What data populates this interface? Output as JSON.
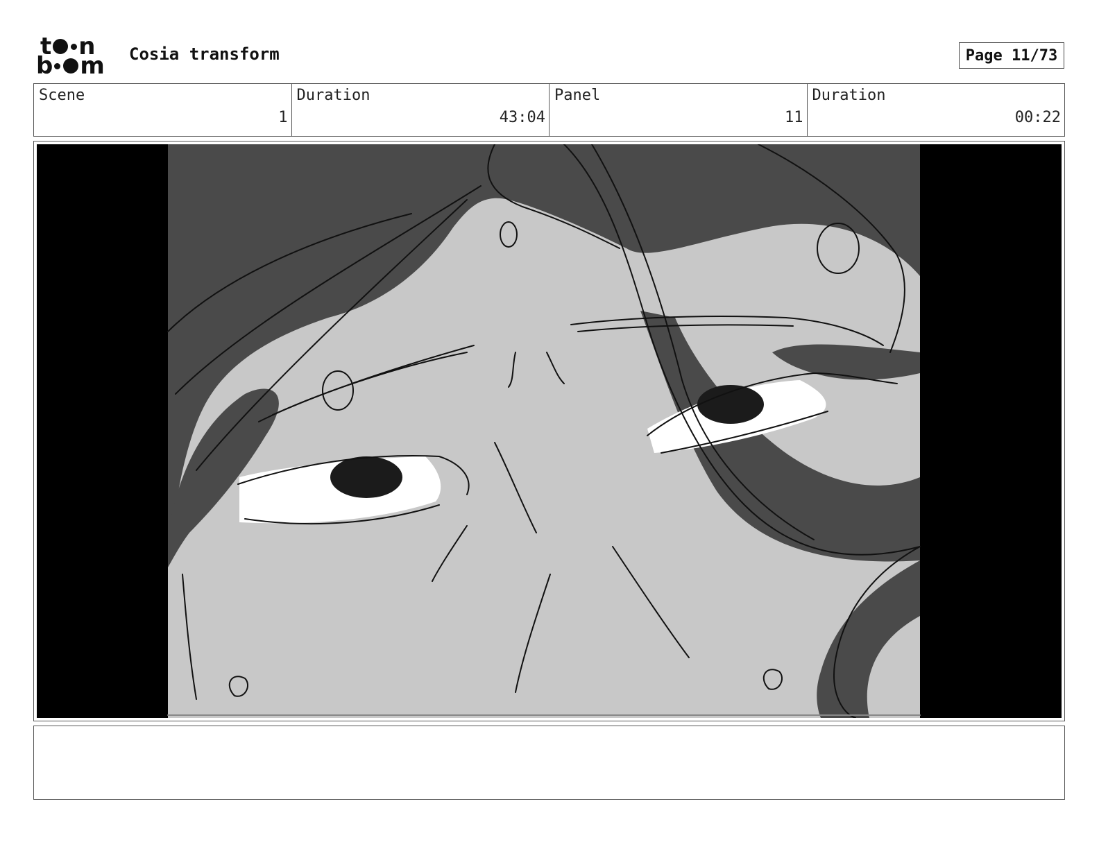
{
  "header": {
    "logo_top_letters": [
      "t",
      "n"
    ],
    "logo_bottom_letters": [
      "b",
      "m"
    ],
    "title": "Cosia transform",
    "page_label": "Page 11/73"
  },
  "info": {
    "scene_label": "Scene",
    "scene_value": "1",
    "scene_duration_label": "Duration",
    "scene_duration_value": "43:04",
    "panel_label": "Panel",
    "panel_value": "11",
    "panel_duration_label": "Duration",
    "panel_duration_value": "00:22"
  },
  "notes": {
    "text": ""
  },
  "colors": {
    "letterbox": "#000000",
    "skin": "#c8c8c8",
    "hair": "#4a4a4a",
    "line": "#111111"
  }
}
